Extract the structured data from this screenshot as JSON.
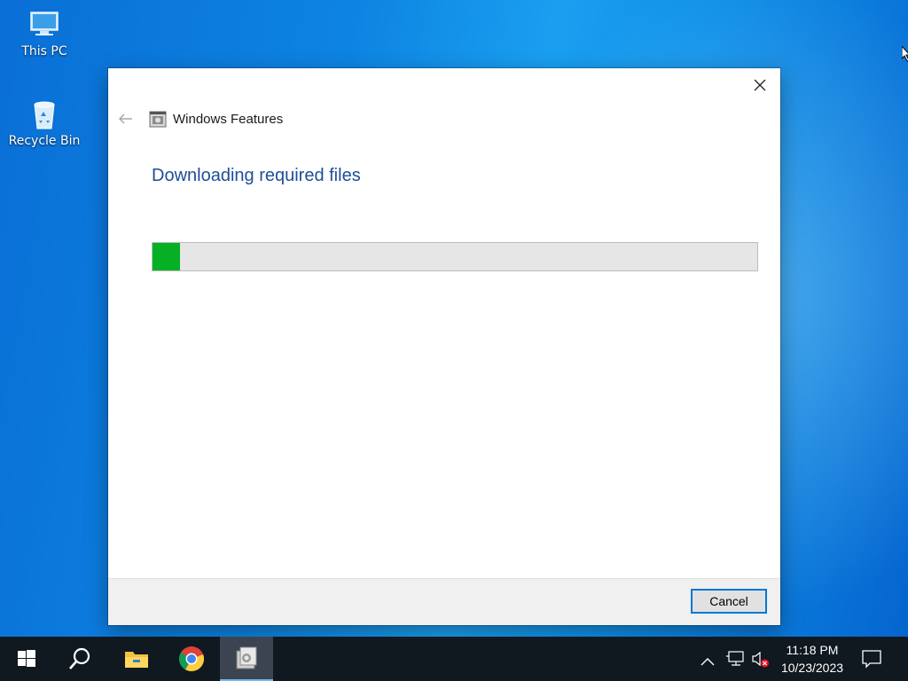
{
  "desktop": {
    "icons": [
      {
        "label": "This PC",
        "icon": "this-pc-icon"
      },
      {
        "label": "Recycle Bin",
        "icon": "recycle-bin-icon"
      }
    ],
    "background_color": "#0a74da"
  },
  "dialog": {
    "title": "Windows Features",
    "heading": "Downloading required files",
    "progress": 0.046,
    "progress_color": "#06b025",
    "heading_color": "#1f4e96",
    "cancel_label": "Cancel",
    "icons": {
      "close": "close-icon",
      "back": "back-arrow-icon",
      "app": "windows-features-icon"
    }
  },
  "taskbar": {
    "buttons": [
      {
        "name": "start",
        "icon": "windows-logo-icon"
      },
      {
        "name": "search",
        "icon": "search-icon"
      },
      {
        "name": "file-explorer",
        "icon": "folder-icon"
      },
      {
        "name": "chrome",
        "icon": "chrome-icon"
      },
      {
        "name": "windows-features",
        "icon": "windows-features-icon",
        "active": true
      }
    ],
    "tray": {
      "icons": [
        "chevron-up-icon",
        "network-icon",
        "volume-muted-icon",
        "action-center-icon"
      ],
      "time": "11:18 PM",
      "date": "10/23/2023"
    }
  }
}
